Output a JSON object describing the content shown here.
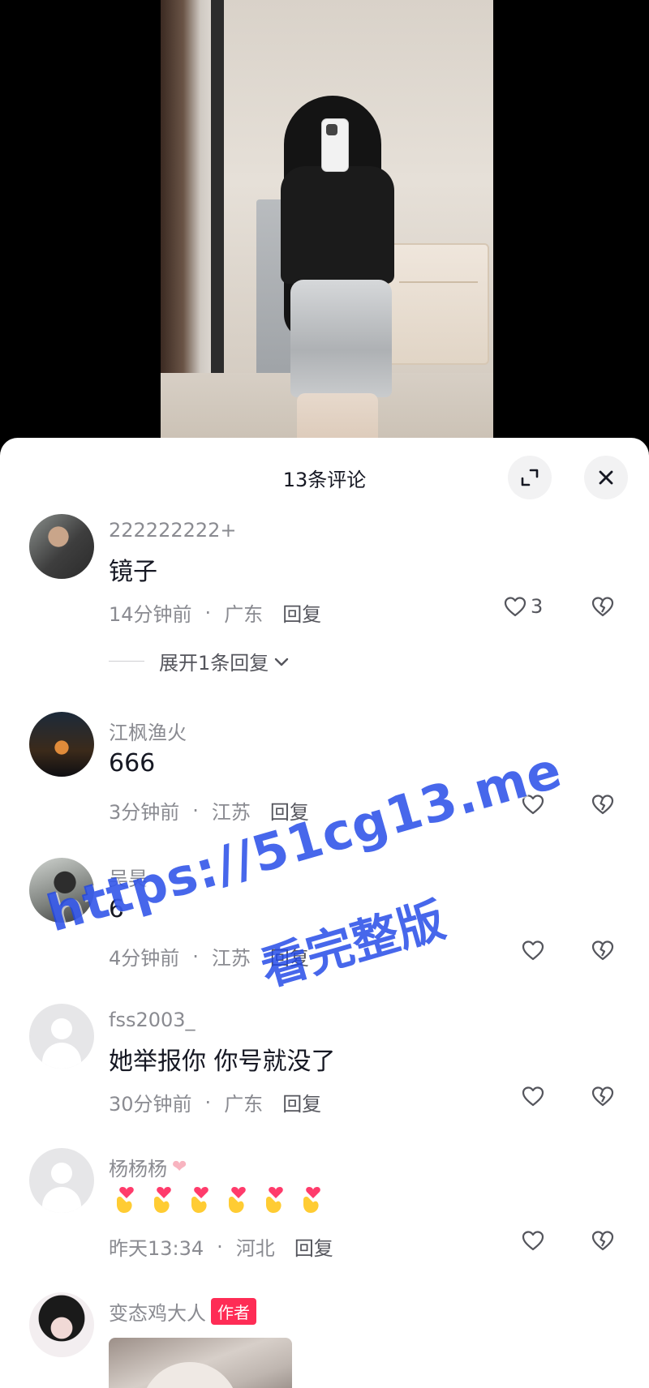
{
  "sheet": {
    "title": "13条评论"
  },
  "comments": [
    {
      "username": "222222222+",
      "content": "镜子",
      "time": "14分钟前",
      "location": "广东",
      "reply": "回复",
      "likes": "3",
      "expand": "展开1条回复"
    },
    {
      "username": "江枫渔火",
      "content": "666",
      "time": "3分钟前",
      "location": "江苏",
      "reply": "回复"
    },
    {
      "username": "吴昊",
      "content": "6",
      "time": "4分钟前",
      "location": "江苏",
      "reply": "回复"
    },
    {
      "username": "fss2003_",
      "content": "她举报你 你号就没了",
      "time": "30分钟前",
      "location": "广东",
      "reply": "回复"
    },
    {
      "username": "杨杨杨",
      "content_emoji_count": 6,
      "time": "昨天13:34",
      "location": "河北",
      "reply": "回复"
    },
    {
      "username": "变态鸡大人",
      "author_tag": "作者"
    }
  ],
  "watermark": {
    "line1": "https://51cg13.me",
    "line2": "看完整版"
  },
  "colors": {
    "accent": "#fe2c55",
    "watermark": "#1e46e6",
    "secondary_text": "#8a8b91"
  }
}
